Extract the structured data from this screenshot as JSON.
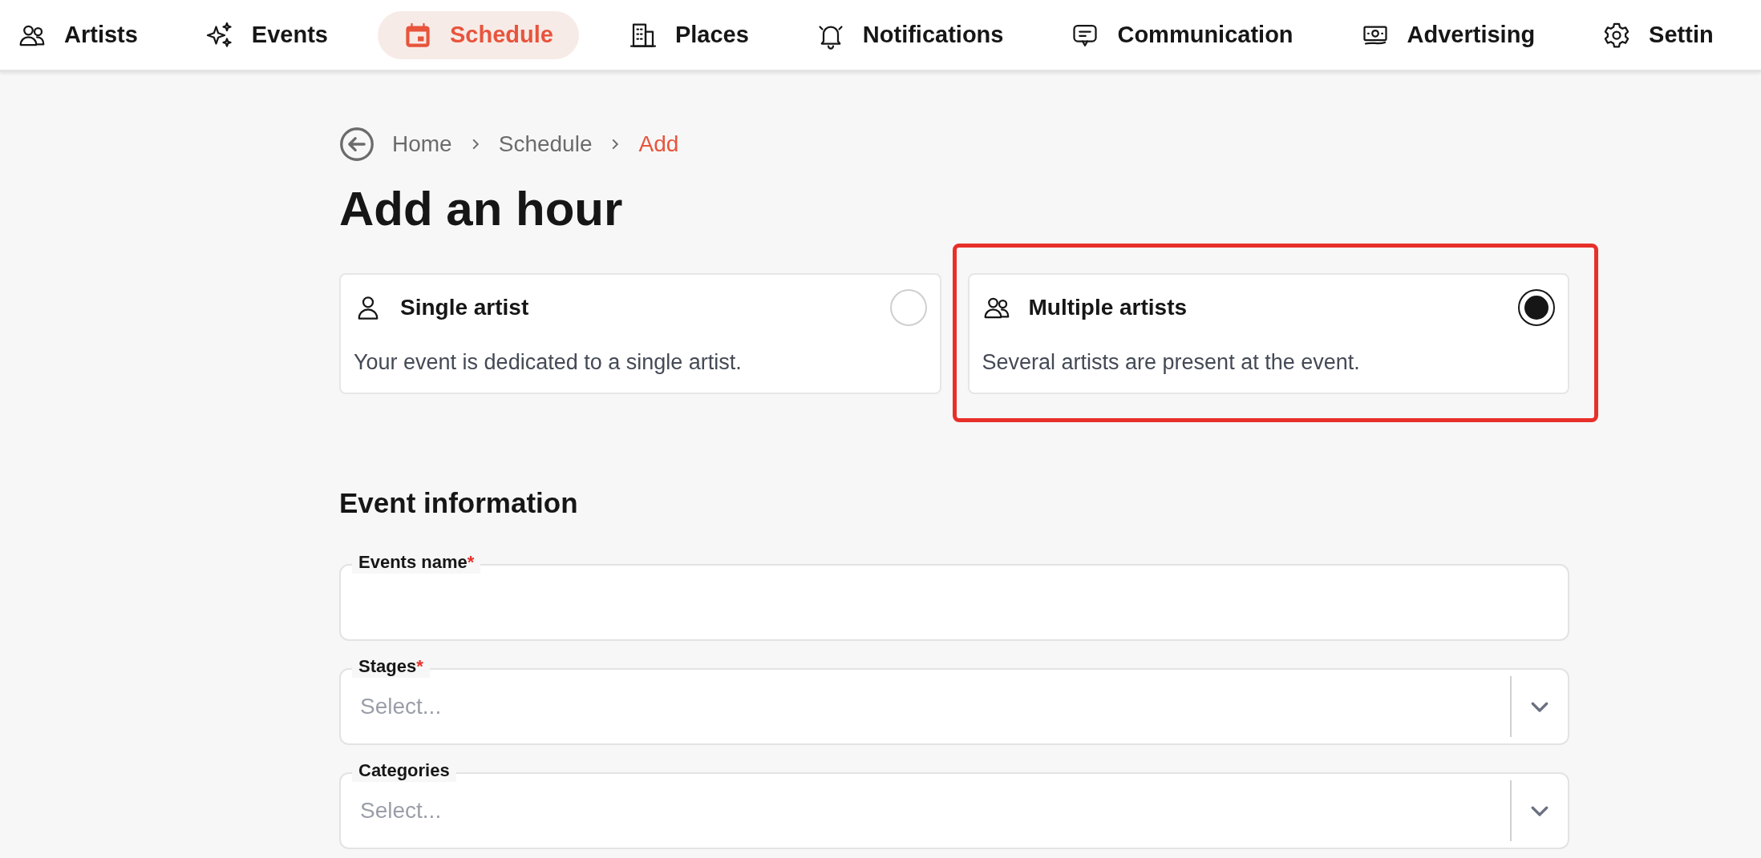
{
  "nav": [
    {
      "label": "Artists",
      "selected": false
    },
    {
      "label": "Events",
      "selected": false
    },
    {
      "label": "Schedule",
      "selected": true
    },
    {
      "label": "Places",
      "selected": false
    },
    {
      "label": "Notifications",
      "selected": false
    },
    {
      "label": "Communication",
      "selected": false
    },
    {
      "label": "Advertising",
      "selected": false
    },
    {
      "label": "Settin",
      "selected": false
    }
  ],
  "breadcrumb": [
    {
      "label": "Home",
      "current": false
    },
    {
      "label": "Schedule",
      "current": false
    },
    {
      "label": "Add",
      "current": true
    }
  ],
  "title": "Add an hour",
  "options": [
    {
      "title": "Single artist",
      "description": "Your event is dedicated to a single artist.",
      "selected": false,
      "highlighted": false
    },
    {
      "title": "Multiple artists",
      "description": "Several artists are present at the event.",
      "selected": true,
      "highlighted": true
    }
  ],
  "section_title": "Event information",
  "fields": [
    {
      "kind": "text",
      "label": "Events name",
      "required_mark": "*"
    },
    {
      "kind": "select",
      "label": "Stages",
      "required_mark": "*",
      "placeholder": "Select..."
    },
    {
      "kind": "select",
      "label": "Categories",
      "placeholder": "Select..."
    }
  ]
}
